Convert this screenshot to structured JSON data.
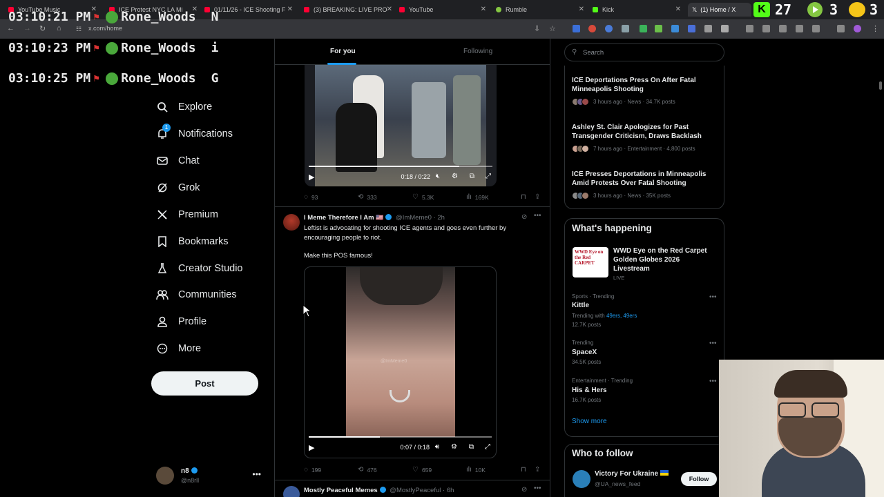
{
  "browser": {
    "tabs": [
      {
        "title": "YouTube Music",
        "color": "#ff0033"
      },
      {
        "title": "ICE Protest NYC LA Mi",
        "color": "#ff0033"
      },
      {
        "title": "01/11/26 - ICE Shooting F",
        "color": "#ff0033"
      },
      {
        "title": "(3) BREAKING: LIVE PRO",
        "color": "#ff0033"
      },
      {
        "title": "YouTube",
        "color": "#ff0033"
      },
      {
        "title": "Rumble",
        "color": "#85c742"
      },
      {
        "title": "Kick",
        "color": "#53fc18"
      },
      {
        "title": "(1) Home / X",
        "color": "#ffffff"
      }
    ],
    "url": "x.com/home"
  },
  "stream_overlay": {
    "chat_lines": [
      {
        "time": "03:10:21 PM",
        "user": "Rone_Woods",
        "msg": "N"
      },
      {
        "time": "03:10:23 PM",
        "user": "Rone_Woods",
        "msg": "i"
      },
      {
        "time": "03:10:25 PM",
        "user": "Rone_Woods",
        "msg": "G"
      }
    ],
    "counter_1": "27",
    "counter_2": "3",
    "counter_3": "3"
  },
  "sidebar": {
    "items": [
      {
        "label": "Explore",
        "icon": "search-icon"
      },
      {
        "label": "Notifications",
        "icon": "bell-icon"
      },
      {
        "label": "Chat",
        "icon": "mail-icon"
      },
      {
        "label": "Grok",
        "icon": "grok-icon"
      },
      {
        "label": "Premium",
        "icon": "x-logo-icon"
      },
      {
        "label": "Bookmarks",
        "icon": "bookmark-icon"
      },
      {
        "label": "Creator Studio",
        "icon": "flask-icon"
      },
      {
        "label": "Communities",
        "icon": "people-icon"
      },
      {
        "label": "Profile",
        "icon": "person-icon"
      },
      {
        "label": "More",
        "icon": "more-circle-icon"
      }
    ],
    "notifications_badge": "1",
    "post_label": "Post",
    "account": {
      "name": "n8",
      "handle": "@n8rll"
    }
  },
  "feed": {
    "tabs": [
      "For you",
      "Following"
    ],
    "tweet1": {
      "video_time": "0:18 / 0:22",
      "progress": 0.82,
      "replies": "93",
      "reposts": "333",
      "likes": "5.3K",
      "views": "169K"
    },
    "tweet2": {
      "name": "I Meme Therefore I Am",
      "handle": "@ImMeme0",
      "age": "2h",
      "text_line1": "Leftist is advocating for shooting ICE agents and goes even further by",
      "text_line2": "encouraging people to riot.",
      "text_line3": "Make this POS famous!",
      "watermark": "@ImMeme0",
      "video_time": "0:07 / 0:18",
      "progress": 0.39,
      "replies": "199",
      "reposts": "476",
      "likes": "659",
      "views": "10K"
    },
    "tweet3": {
      "name": "Mostly Peaceful Memes",
      "handle": "@MostlyPeaceful",
      "age": "6h"
    }
  },
  "right": {
    "search_placeholder": "Search",
    "news": [
      {
        "title": "ICE Deportations Press On After Fatal Minneapolis Shooting",
        "meta": "3 hours ago · News · 34.7K posts"
      },
      {
        "title": "Ashley St. Clair Apologizes for Past Transgender Criticism, Draws Backlash",
        "meta": "7 hours ago · Entertainment · 4,800 posts"
      },
      {
        "title": "ICE Presses Deportations in Minneapolis Amid Protests Over Fatal Shooting",
        "meta": "3 hours ago · News · 35K posts"
      }
    ],
    "whats_happening": "What's happening",
    "live_event": {
      "title": "WWD Eye on the Red Carpet Golden Globes 2026 Livestream",
      "status": "LIVE",
      "thumb_text": "WWD Eye on the Red CARPET"
    },
    "trends": [
      {
        "category": "Sports · Trending",
        "name": "Kittle",
        "extra_prefix": "Trending with ",
        "extra_links": "49ers, 49ers",
        "count": "12.7K posts"
      },
      {
        "category": "Trending",
        "name": "SpaceX",
        "count": "34.5K posts"
      },
      {
        "category": "Entertainment · Trending",
        "name": "His & Hers",
        "count": "16.7K posts"
      }
    ],
    "show_more": "Show more",
    "who_to_follow": "Who to follow",
    "follow_suggestion": {
      "name": "Victory For Ukraine",
      "handle": "@UA_news_feed",
      "button": "Follow"
    }
  }
}
